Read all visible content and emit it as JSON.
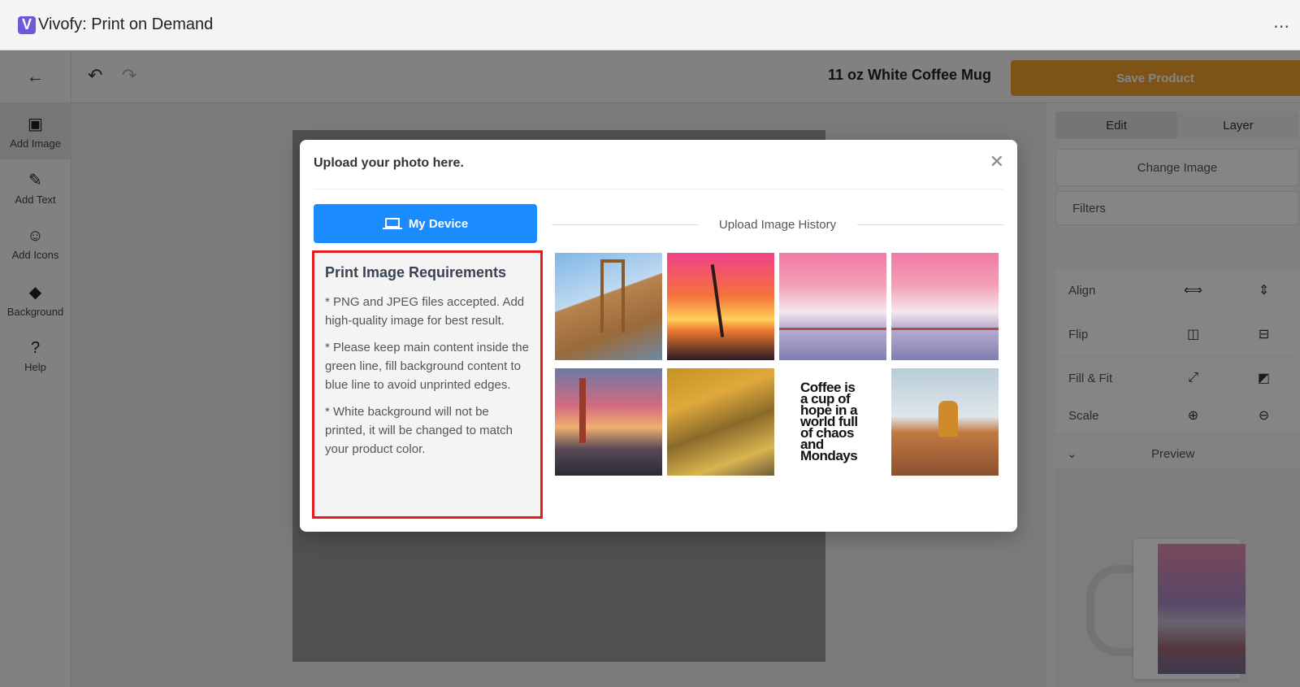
{
  "app": {
    "logo_letter": "V",
    "title": "Vivofy: Print on Demand",
    "more_label": "⋯"
  },
  "left_rail": {
    "items": [
      {
        "label": "Add Image",
        "icon": "image-icon",
        "glyph": "▣"
      },
      {
        "label": "Add Text",
        "icon": "pencil-icon",
        "glyph": "✎"
      },
      {
        "label": "Add Icons",
        "icon": "smiley-icon",
        "glyph": "☺"
      },
      {
        "label": "Background",
        "icon": "paint-bucket-icon",
        "glyph": "◆"
      },
      {
        "label": "Help",
        "icon": "question-icon",
        "glyph": "?"
      }
    ]
  },
  "toolbar": {
    "back_glyph": "←",
    "undo_glyph": "↶",
    "redo_glyph": "↷",
    "product_name": "11 oz White Coffee Mug",
    "save_label": "Save Product"
  },
  "right_panel": {
    "tab_edit": "Edit",
    "tab_layer": "Layer",
    "change_image": "Change Image",
    "filters": "Filters",
    "align": "Align",
    "flip": "Flip",
    "fill_fit": "Fill & Fit",
    "scale": "Scale",
    "preview": "Preview"
  },
  "modal": {
    "title": "Upload your photo here.",
    "close_glyph": "✕",
    "my_device": "My Device",
    "history_label": "Upload Image History",
    "requirements": {
      "title": "Print Image Requirements",
      "lines": [
        "* PNG and JPEG files accepted. Add high-quality image for best result.",
        "* Please keep main content inside the green line, fill background content to blue line to avoid unprinted edges.",
        "* White background will not be printed, it will be changed to match your product color."
      ]
    },
    "thumbnail_text": "Coffee is a cup of hope in a world full of chaos and Mondays"
  },
  "colors": {
    "brand": "#6b5bd6",
    "primary_button": "#1a8cff",
    "save_button": "#f0a02c",
    "highlight_border": "#e51c1c"
  }
}
